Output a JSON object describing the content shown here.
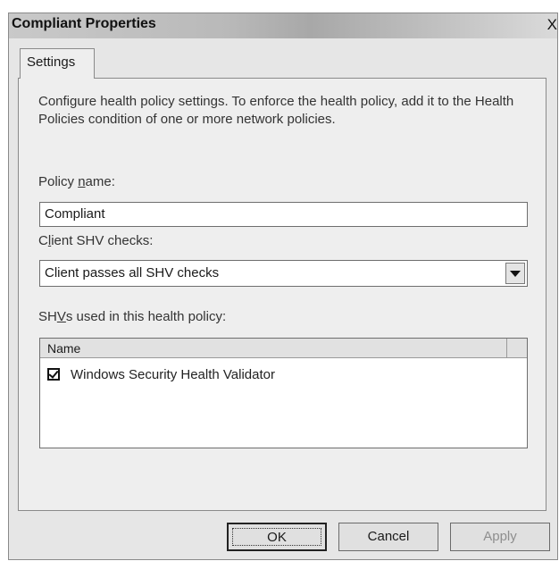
{
  "window": {
    "title": "Compliant Properties",
    "close_glyph": "X"
  },
  "tabs": [
    {
      "label": "Settings"
    }
  ],
  "settings": {
    "description": "Configure health policy settings. To enforce the health policy, add it to the Health Policies condition of one or more network policies.",
    "policy_name_label": "Policy name:",
    "policy_name_value": "Compliant",
    "client_checks_label": "Client SHV checks:",
    "client_checks_value": "Client passes all SHV checks",
    "shvs_label": "SHVs used in this health policy:",
    "shv_table": {
      "columns": [
        "Name"
      ],
      "rows": [
        {
          "name": "Windows Security Health Validator",
          "checked": true
        }
      ]
    }
  },
  "buttons": {
    "ok": "OK",
    "cancel": "Cancel",
    "apply": "Apply"
  },
  "icons": {
    "close": "close-icon",
    "dropdown": "chevron-down-icon",
    "checkbox": "checkbox-checked-icon"
  }
}
